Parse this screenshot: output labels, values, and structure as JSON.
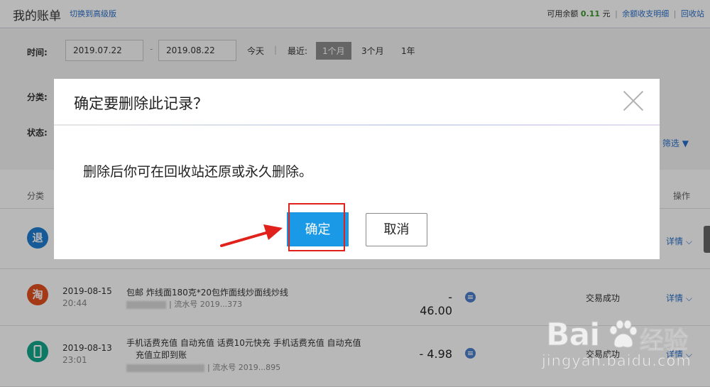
{
  "header": {
    "title": "我的账单",
    "switch_link": "切换到高级版",
    "balance_label": "可用余额",
    "balance_value": "0.11",
    "balance_unit": "元",
    "balance_detail_link": "余额收支明细",
    "recycle_link": "回收站"
  },
  "filter": {
    "time_label": "时间:",
    "date_from": "2019.07.22",
    "date_to": "2019.08.22",
    "dash": "-",
    "today": "今天",
    "recent_label": "最近:",
    "periods": [
      "1个月",
      "3个月",
      "1年"
    ],
    "active_period": "1个月",
    "category_label": "分类:",
    "status_label": "状态:",
    "more_filter": "筛选"
  },
  "list": {
    "headers": {
      "category": "分类",
      "action": "操作"
    },
    "rows": [
      {
        "icon_text": "退",
        "icon_name": "refund-icon",
        "detail": "详情"
      },
      {
        "icon_text": "淘",
        "icon_name": "taobao-icon",
        "date": "2019-08-15",
        "time": "20:44",
        "name": "包邮 炸线面180克*20包炸面线炒面线炒线",
        "serial": "| 流水号 2019...373",
        "amount": "- 46.00",
        "status": "交易成功",
        "detail": "详情"
      },
      {
        "icon_text": "",
        "icon_name": "phone-icon",
        "date": "2019-08-13",
        "time": "23:01",
        "name": "手机话费充值 自动充值   话费10元快充 手机话费充值 自动充值",
        "name_line2": "充值立即到账",
        "serial": "| 流水号 2019...895",
        "amount": "- 4.98",
        "status": "交易成功",
        "detail": "详情"
      }
    ]
  },
  "dialog": {
    "title": "确定要删除此记录？",
    "message": "删除后你可在回收站还原或永久删除。",
    "ok_label": "确定",
    "cancel_label": "取消"
  },
  "annotation": {
    "box_color": "#e0211c",
    "arrow_color": "#e0211c"
  },
  "watermark": {
    "brand_left": "Bai",
    "brand_right": "经验",
    "url": "jingyan.baidu.com"
  },
  "colors": {
    "accent_link": "#2a6fc9",
    "ok_button": "#1a9ae6",
    "balance_value": "#3a9a2a"
  }
}
